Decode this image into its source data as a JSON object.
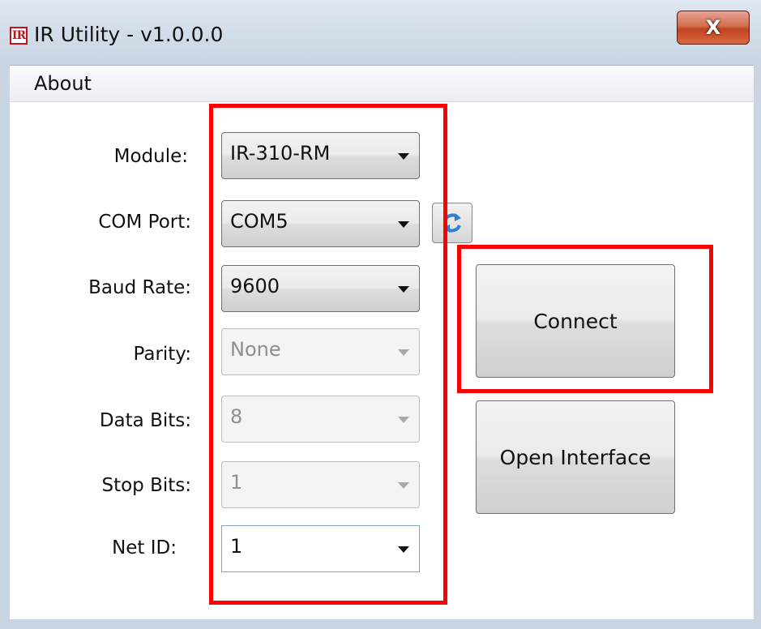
{
  "window": {
    "title": "IR Utility - v1.0.0.0",
    "icon_text": "IR",
    "close_glyph": "X"
  },
  "menu": {
    "about": "About"
  },
  "form": {
    "module": {
      "label": "Module:",
      "value": "IR-310-RM",
      "enabled": true
    },
    "com_port": {
      "label": "COM Port:",
      "value": "COM5",
      "enabled": true
    },
    "baud_rate": {
      "label": "Baud Rate:",
      "value": "9600",
      "enabled": true
    },
    "parity": {
      "label": "Parity:",
      "value": "None",
      "enabled": false
    },
    "data_bits": {
      "label": "Data Bits:",
      "value": "8",
      "enabled": false
    },
    "stop_bits": {
      "label": "Stop Bits:",
      "value": "1",
      "enabled": false
    },
    "net_id": {
      "label": "Net ID:",
      "value": "1",
      "enabled": true
    }
  },
  "buttons": {
    "connect": "Connect",
    "open_interface": "Open Interface"
  },
  "icons": {
    "app": "ir-logo-icon",
    "close": "close-icon",
    "refresh": "refresh-icon",
    "dropdown": "chevron-down-icon"
  },
  "colors": {
    "highlight": "#ff0000",
    "close_button": "#c2431f",
    "refresh_arrows": "#2f7fd6"
  }
}
